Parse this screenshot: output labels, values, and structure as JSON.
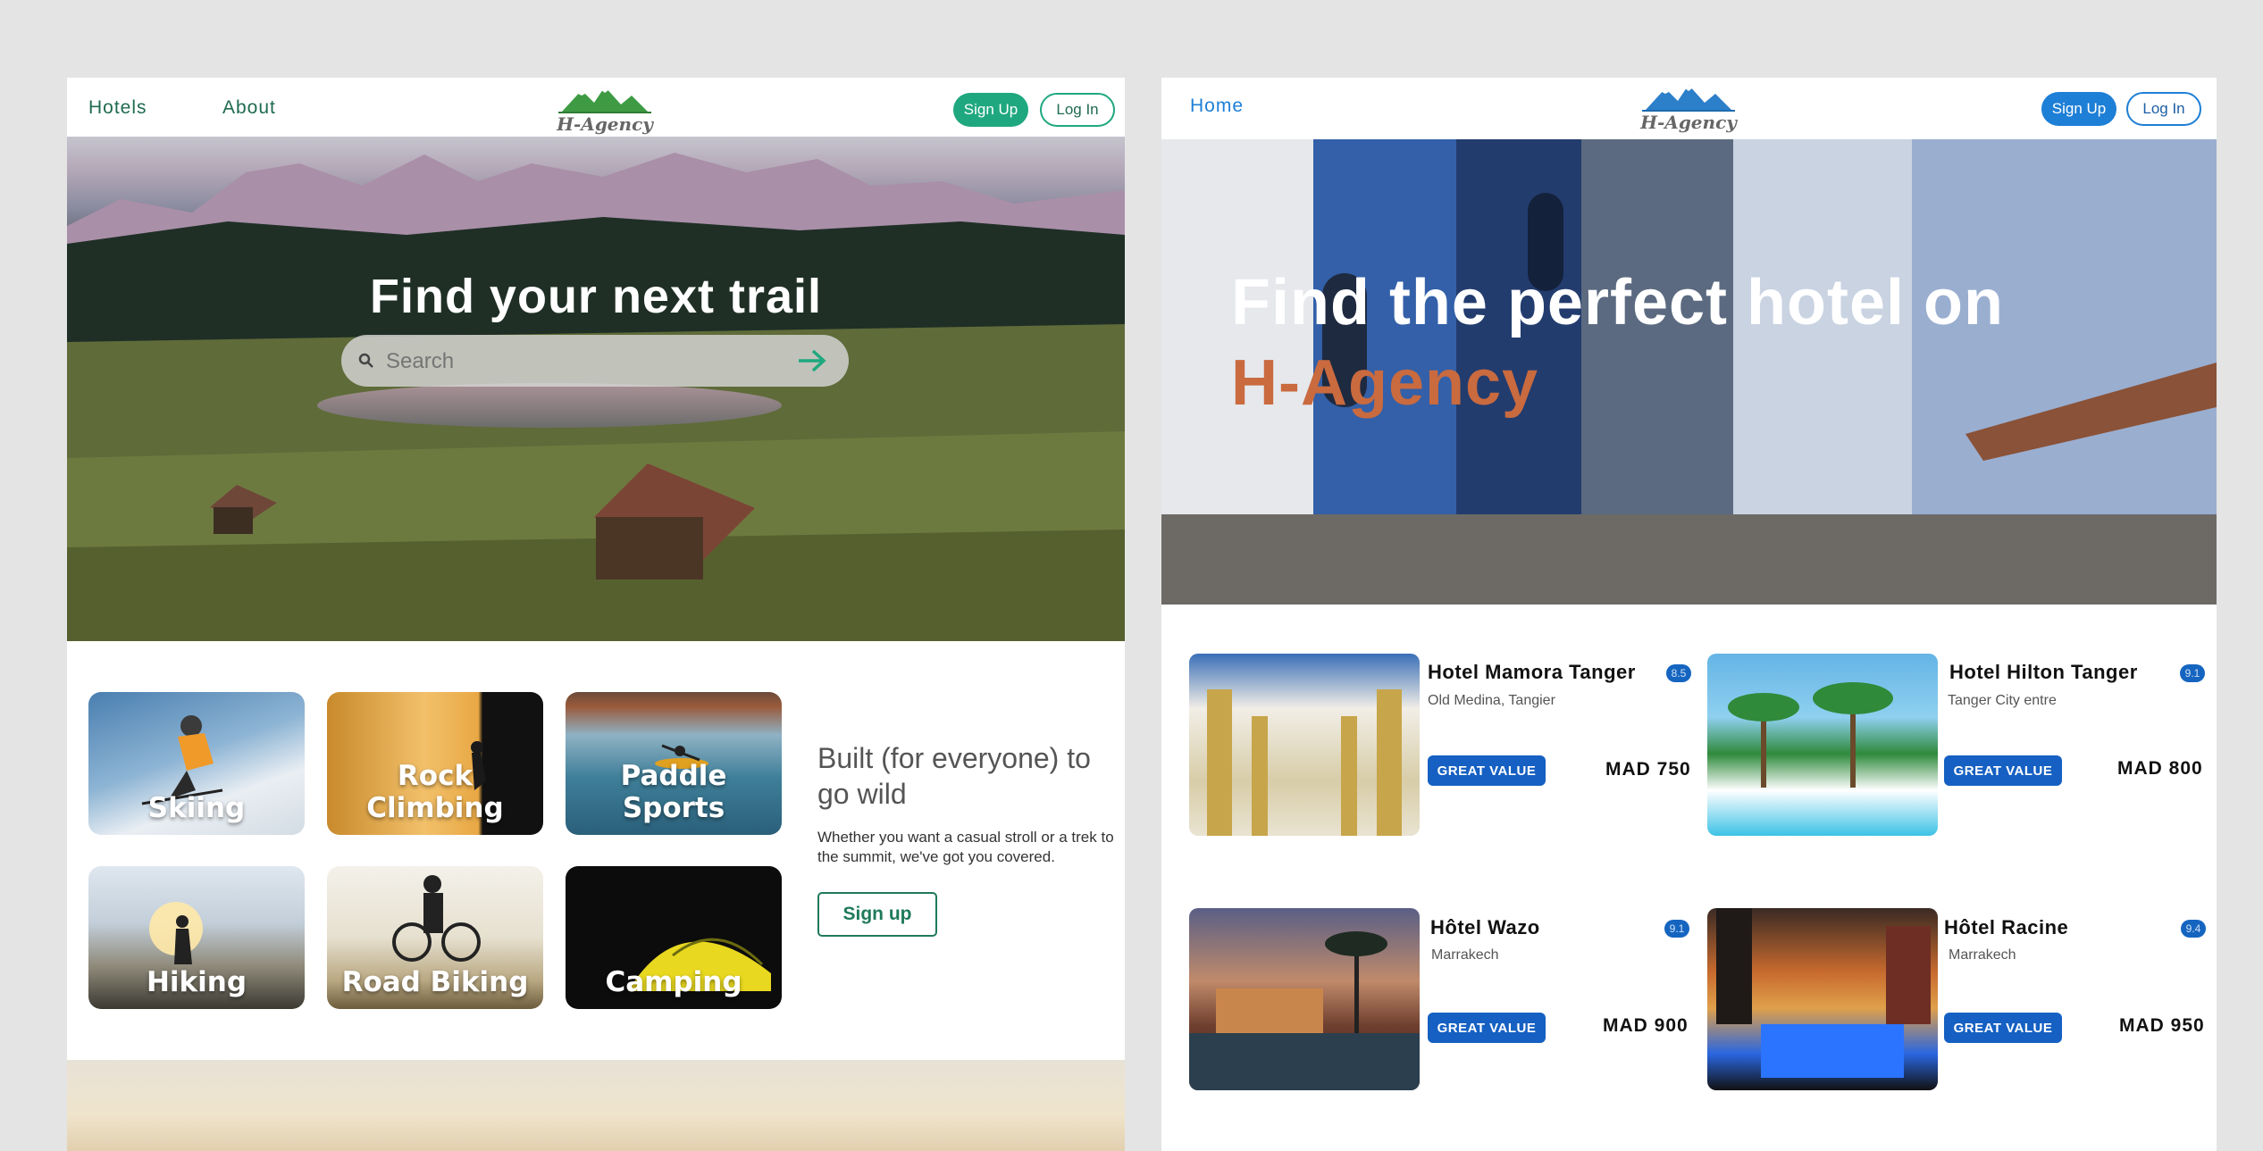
{
  "left": {
    "nav": {
      "hotels": "Hotels",
      "about": "About",
      "logo_text": "H-Agency",
      "signup": "Sign Up",
      "login": "Log In"
    },
    "hero": {
      "title": "Find your next trail",
      "search_placeholder": "Search"
    },
    "activities": [
      {
        "label": "Skiing"
      },
      {
        "label": "Rock Climbing"
      },
      {
        "label": "Paddle Sports"
      },
      {
        "label": "Hiking"
      },
      {
        "label": "Road Biking"
      },
      {
        "label": "Camping"
      }
    ],
    "built": {
      "heading": "Built (for everyone) to go wild",
      "text": "Whether you want a casual stroll or a trek to the summit, we've got you covered.",
      "signup": "Sign up"
    },
    "colors": {
      "accent": "#1fa87f",
      "dark_green": "#1f7a5a"
    }
  },
  "right": {
    "nav": {
      "home": "Home",
      "logo_text": "H-Agency",
      "signup": "Sign Up",
      "login": "Log In"
    },
    "hero": {
      "line1": "Find the perfect hotel on",
      "line2": "H-Agency"
    },
    "hotels": [
      {
        "name": "Hotel Mamora Tanger",
        "location": "Old Medina, Tangier",
        "rating": "8.5",
        "badge": "GREAT VALUE",
        "price": "MAD 750"
      },
      {
        "name": "Hotel Hilton Tanger",
        "location": "Tanger City entre",
        "rating": "9.1",
        "badge": "GREAT VALUE",
        "price": "MAD 800"
      },
      {
        "name": "Hôtel Wazo",
        "location": "Marrakech",
        "rating": "9.1",
        "badge": "GREAT VALUE",
        "price": "MAD 900"
      },
      {
        "name": "Hôtel Racine",
        "location": "Marrakech",
        "rating": "9.4",
        "badge": "GREAT VALUE",
        "price": "MAD 950"
      }
    ],
    "colors": {
      "accent": "#1e7fd6",
      "hero_accent": "#c96a3f"
    }
  }
}
